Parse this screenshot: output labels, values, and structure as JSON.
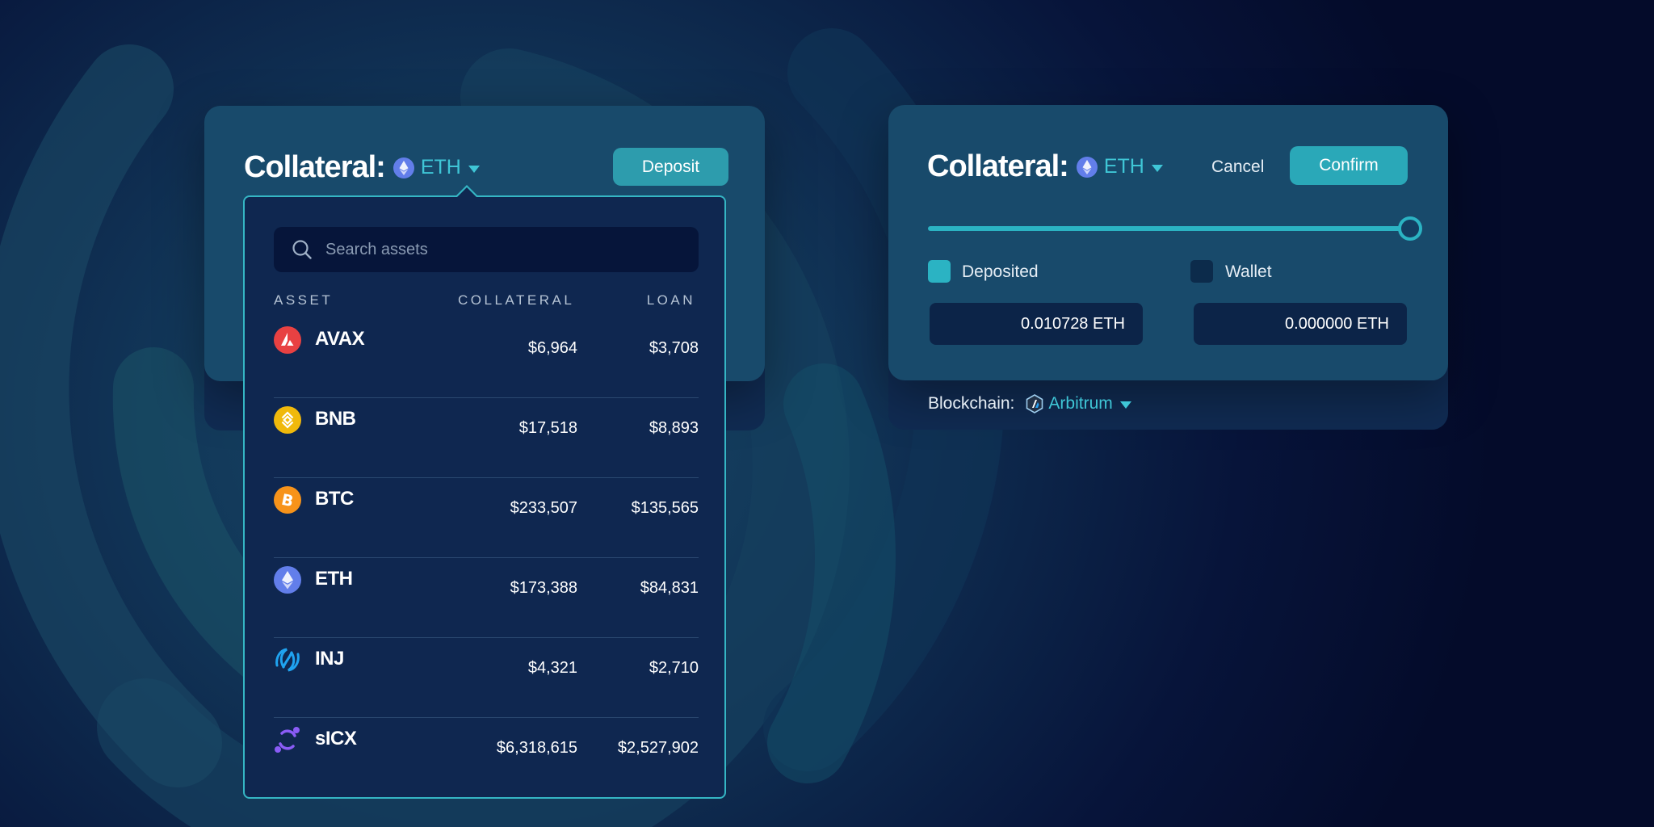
{
  "left_card": {
    "title": "Collateral:",
    "asset": "ETH",
    "deposit_label": "Deposit"
  },
  "dropdown": {
    "search_placeholder": "Search assets",
    "columns": {
      "asset": "ASSET",
      "collateral": "COLLATERAL",
      "loan": "LOAN"
    },
    "rows": [
      {
        "name": "AVAX",
        "collateral": "$6,964",
        "loan": "$3,708",
        "icon": "avax-icon"
      },
      {
        "name": "BNB",
        "collateral": "$17,518",
        "loan": "$8,893",
        "icon": "bnb-icon"
      },
      {
        "name": "BTC",
        "collateral": "$233,507",
        "loan": "$135,565",
        "icon": "btc-icon"
      },
      {
        "name": "ETH",
        "collateral": "$173,388",
        "loan": "$84,831",
        "icon": "eth-icon"
      },
      {
        "name": "INJ",
        "collateral": "$4,321",
        "loan": "$2,710",
        "icon": "inj-icon"
      },
      {
        "name": "sICX",
        "collateral": "$6,318,615",
        "loan": "$2,527,902",
        "icon": "icx-icon"
      }
    ]
  },
  "right_card": {
    "title": "Collateral:",
    "asset": "ETH",
    "cancel_label": "Cancel",
    "confirm_label": "Confirm",
    "slider_value": 1.0,
    "deposited_label": "Deposited",
    "deposited_checked": true,
    "wallet_label": "Wallet",
    "wallet_checked": false,
    "deposited_amount": "0.010728 ETH",
    "wallet_amount": "0.000000 ETH",
    "blockchain_label": "Blockchain:",
    "blockchain_name": "Arbitrum"
  },
  "colors": {
    "accent": "#3fc6d6",
    "button": "#2aa8b8",
    "card": "#184a6b",
    "panel": "#0f2750"
  }
}
